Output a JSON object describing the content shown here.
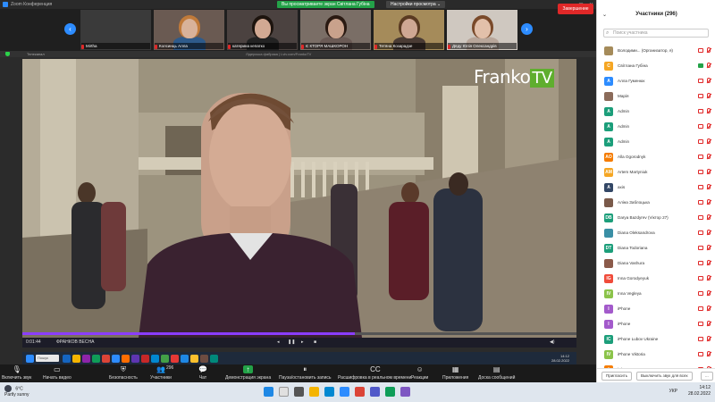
{
  "window": {
    "title": "Zoom Конференция",
    "viewing_label": "Вы просматриваете экран Світлана Губіна",
    "view_options": "Настройки просмотра ⌄"
  },
  "thumbnails": [
    {
      "name": "Mirtha",
      "bg": "#3a3a3a"
    },
    {
      "name": "Колсинць Алла",
      "bg": "#6a5a52"
    },
    {
      "name": "катерина кепатко",
      "bg": "#4b4240"
    },
    {
      "name": "Є КТОРЯ МАШКОРОН",
      "bg": "#7a6e66"
    },
    {
      "name": "Тетяна Козарадзе",
      "bg": "#a58b5a"
    },
    {
      "name": "Дяду Юлія Олександрів",
      "bg": "#cfc8c0"
    }
  ],
  "share": {
    "title_text": "Лідерська фабрика | Lviv.com/FrankoTV",
    "player_top_left": "Телеканал",
    "logo_main": "Franko",
    "logo_tv": "TV",
    "time_elapsed": "0:01:44",
    "clip_label": "ФРАНКОВ ВЕСНА",
    "progress": 0.6,
    "host_search": "Пошук"
  },
  "host_clock": {
    "time": "14:12",
    "date": "28.02.2022"
  },
  "toolbar": {
    "items": [
      {
        "label": "Включить звук",
        "icon": "🎙"
      },
      {
        "label": "Начать видео",
        "icon": "▭"
      },
      {
        "label": "Безопасность",
        "icon": "⛨"
      },
      {
        "label": "Участники",
        "icon": "👥",
        "count": "296"
      },
      {
        "label": "Чат",
        "icon": "💬"
      },
      {
        "label": "Демонстрация экрана",
        "icon": "↑"
      },
      {
        "label": "Пауза/остановить запись",
        "icon": "⏸"
      },
      {
        "label": "Расшифровка в реальном времени",
        "icon": "CC"
      },
      {
        "label": "Реакции",
        "icon": "☺"
      },
      {
        "label": "Приложения",
        "icon": "▦"
      },
      {
        "label": "Доска сообщений",
        "icon": "▤"
      }
    ],
    "end_label": "Завершение"
  },
  "panel": {
    "title": "Участники (296)",
    "search_placeholder": "Поиск участника",
    "participants": [
      {
        "initials": "",
        "name": "Володими... (Организатор, я)",
        "color": "#a58b5a"
      },
      {
        "initials": "С",
        "name": "Світлана Губіна",
        "color": "#f5a623"
      },
      {
        "initials": "А",
        "name": "Алла Гуменюк",
        "color": "#2d8cff"
      },
      {
        "initials": "",
        "name": "Марія",
        "color": "#8b6b5a"
      },
      {
        "initials": "A",
        "name": "Admin",
        "color": "#1c9e7a"
      },
      {
        "initials": "A",
        "name": "Admin",
        "color": "#1c9e7a"
      },
      {
        "initials": "A",
        "name": "Admin",
        "color": "#1c9e7a"
      },
      {
        "initials": "AO",
        "name": "Alla Ogorodnyk",
        "color": "#f57c00"
      },
      {
        "initials": "AM",
        "name": "Artem Martyniuk",
        "color": "#f5a623"
      },
      {
        "initials": "A",
        "name": "axis",
        "color": "#334766"
      },
      {
        "initials": "",
        "name": "Аліна Заблоцька",
        "color": "#7a5a4a"
      },
      {
        "initials": "DB",
        "name": "Darya Bazdyrev (Vіктор 27)",
        "color": "#1c9e7a"
      },
      {
        "initials": "",
        "name": "Diana Oleksandrova",
        "color": "#3a8fa5"
      },
      {
        "initials": "DT",
        "name": "Diana Todoriana",
        "color": "#1c9e7a"
      },
      {
        "initials": "",
        "name": "Diana Vashura",
        "color": "#8b5a4a"
      },
      {
        "initials": "IG",
        "name": "Inna Gorodyeyuk",
        "color": "#f04b3a"
      },
      {
        "initials": "IV",
        "name": "Inna Vegleya",
        "color": "#8bc34a"
      },
      {
        "initials": "I",
        "name": "iPhone",
        "color": "#a35acb"
      },
      {
        "initials": "I",
        "name": "iPhone",
        "color": "#a35acb"
      },
      {
        "initials": "IC",
        "name": "iPhone Lubov Ukraine",
        "color": "#1c9e7a"
      },
      {
        "initials": "IV",
        "name": "iPhone Viktoria",
        "color": "#8bc34a"
      },
      {
        "initials": "I",
        "name": "iPhone",
        "color": "#f57c00"
      }
    ],
    "invite_label": "Пригласить",
    "mute_all_label": "Выключить звук для всех",
    "more_label": "..."
  },
  "taskbar": {
    "weather_temp": "6°C",
    "weather_desc": "Partly sunny",
    "lang": "УКР",
    "time": "14:12",
    "date": "28.02.2022"
  }
}
